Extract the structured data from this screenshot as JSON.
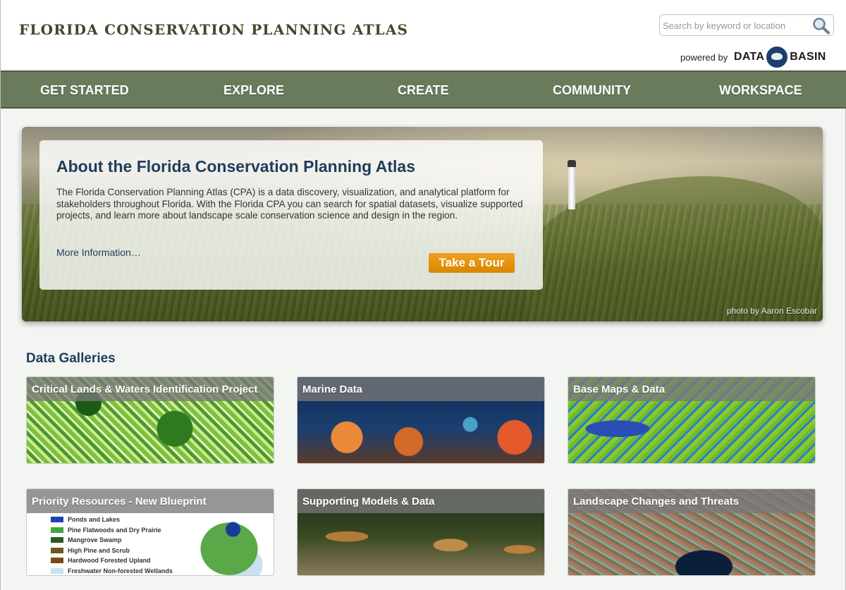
{
  "header": {
    "site_title": "FLORIDA CONSERVATION PLANNING ATLAS",
    "search_placeholder": "Search by keyword or location",
    "powered_by": "powered by",
    "logo_left": "DATA",
    "logo_right": "BASIN"
  },
  "nav": {
    "items": [
      "GET STARTED",
      "EXPLORE",
      "CREATE",
      "COMMUNITY",
      "WORKSPACE"
    ]
  },
  "hero": {
    "title": "About the Florida Conservation Planning Atlas",
    "body": "The Florida Conservation Planning Atlas (CPA) is a data discovery, visualization, and analytical platform for stakeholders throughout Florida. With the Florida CPA you can search for spatial datasets, visualize supported projects, and learn more about landscape scale conservation science and design in the region.",
    "more_link": "More Information…",
    "tour_button": "Take a Tour",
    "photo_credit": "photo by Aaron Escobar"
  },
  "galleries": {
    "heading": "Data Galleries",
    "tiles": [
      "Critical Lands & Waters Identification Project",
      "Marine Data",
      "Base Maps & Data",
      "Priority Resources - New Blueprint",
      "Supporting Models & Data",
      "Landscape Changes and Threats"
    ],
    "priority_legend": [
      {
        "label": "Ponds and Lakes",
        "color": "#1f3fb8"
      },
      {
        "label": "Pine Flatwoods and Dry Prairie",
        "color": "#3ea63a"
      },
      {
        "label": "Mangrove Swamp",
        "color": "#2d5a1e"
      },
      {
        "label": "High Pine and Scrub",
        "color": "#6a5a1e"
      },
      {
        "label": "Hardwood Forested Upland",
        "color": "#7a4a1a"
      },
      {
        "label": "Freshwater Non-forested Wetlands",
        "color": "#c7e3f5"
      }
    ]
  }
}
